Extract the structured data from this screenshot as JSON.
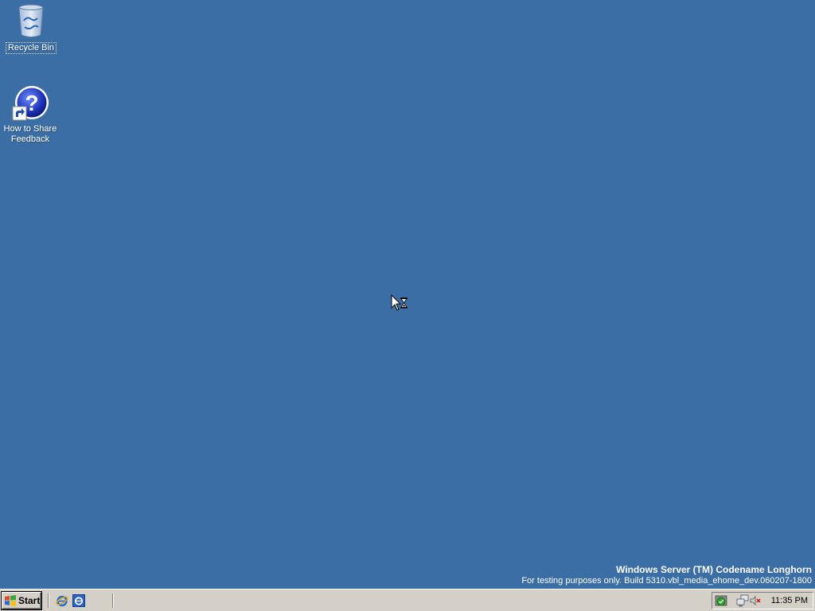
{
  "desktop": {
    "background_color": "#3b6ea5",
    "icons": [
      {
        "label": "Recycle Bin",
        "icon": "recycle-bin-icon",
        "selected": true
      },
      {
        "label": "How to Share Feedback",
        "label_line1": "How to Share",
        "label_line2": "Feedback",
        "icon": "help-shortcut-icon",
        "selected": false
      }
    ],
    "watermark": {
      "title": "Windows Server (TM) Codename Longhorn",
      "subtitle": "For testing purposes only. Build 5310.vbl_media_ehome_dev.060207-1800"
    }
  },
  "taskbar": {
    "start_label": "Start",
    "quick_launch": [
      {
        "icon": "internet-explorer-icon"
      },
      {
        "icon": "ie-browser-icon"
      }
    ],
    "tray": {
      "icons": [
        "security-shield-icon",
        "network-icon",
        "volume-muted-icon"
      ],
      "clock": "11:35 PM"
    }
  },
  "cursor": {
    "icon": "busy-arrow-cursor-icon"
  }
}
